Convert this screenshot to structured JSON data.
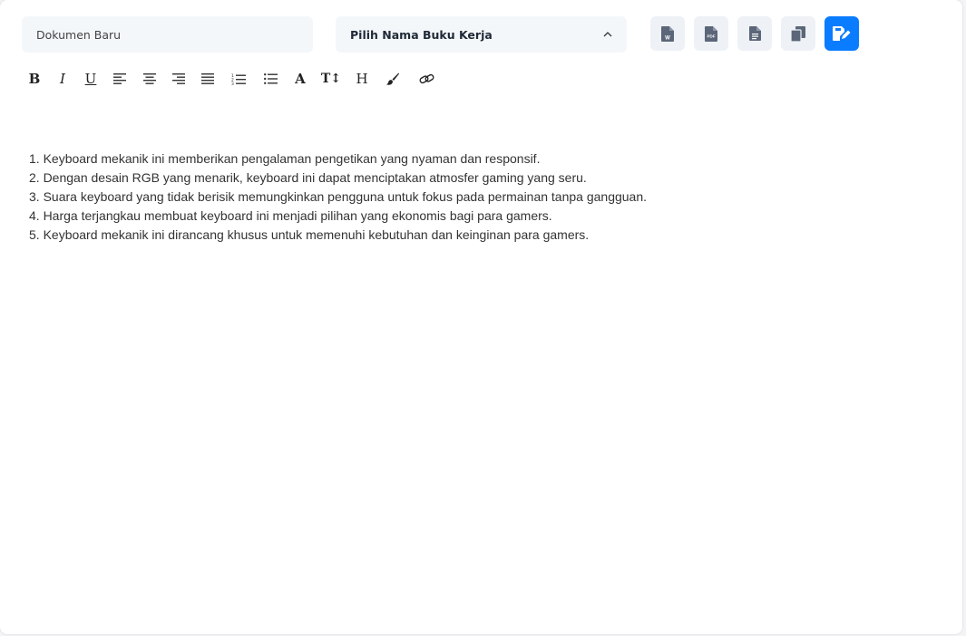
{
  "document": {
    "name_placeholder": "Dokumen Baru"
  },
  "workbook_select": {
    "label": "Pilih Nama Buku Kerja"
  },
  "actions": [
    {
      "icon": "word-file-icon",
      "badge": "W"
    },
    {
      "icon": "pdf-file-icon",
      "badge": "PDF"
    },
    {
      "icon": "text-file-icon"
    },
    {
      "icon": "copy-icon"
    },
    {
      "icon": "edit-save-icon"
    }
  ],
  "toolbar": {
    "bold": "B",
    "italic": "I",
    "underline": "U",
    "font_color": "A",
    "font_size": "T↕",
    "heading": "H"
  },
  "content": {
    "items": [
      "1. Keyboard mekanik ini memberikan pengalaman pengetikan yang nyaman dan responsif.",
      "2. Dengan desain RGB yang menarik, keyboard ini dapat menciptakan atmosfer gaming yang seru.",
      "3. Suara keyboard yang tidak berisik memungkinkan pengguna untuk fokus pada permainan tanpa gangguan.",
      "4. Harga terjangkau membuat keyboard ini menjadi pilihan yang ekonomis bagi para gamers.",
      "5. Keyboard mekanik ini dirancang khusus untuk memenuhi kebutuhan dan keinginan para gamers."
    ]
  },
  "colors": {
    "primary": "#0a7cff",
    "button_bg": "#eef1f6",
    "icon": "#5b6678"
  }
}
